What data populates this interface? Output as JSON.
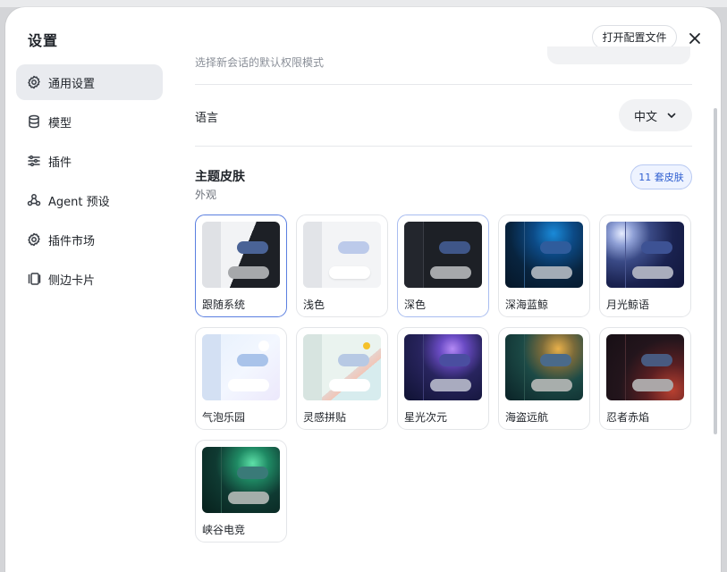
{
  "dialog": {
    "title": "设置",
    "open_config_label": "打开配置文件"
  },
  "sidebar": {
    "items": [
      {
        "label": "通用设置",
        "icon": "gear-icon",
        "active": true
      },
      {
        "label": "模型",
        "icon": "database-icon",
        "active": false
      },
      {
        "label": "插件",
        "icon": "sliders-icon",
        "active": false
      },
      {
        "label": "Agent 预设",
        "icon": "agent-icon",
        "active": false
      },
      {
        "label": "插件市场",
        "icon": "gear-icon",
        "active": false
      },
      {
        "label": "侧边卡片",
        "icon": "cards-icon",
        "active": false
      }
    ]
  },
  "general": {
    "permission_desc": "选择新会话的默认权限模式",
    "language_label": "语言",
    "language_value": "中文",
    "theme_title": "主题皮肤",
    "theme_subtitle": "外观",
    "theme_count": "11 套皮肤"
  },
  "themes": [
    {
      "label": "跟随系统",
      "variant": "system",
      "selected": "strong"
    },
    {
      "label": "浅色",
      "variant": "light"
    },
    {
      "label": "深色",
      "variant": "dark",
      "selected": "soft"
    },
    {
      "label": "深海蓝鲸",
      "variant": "ocean"
    },
    {
      "label": "月光鲸语",
      "variant": "moon"
    },
    {
      "label": "气泡乐园",
      "variant": "bubble"
    },
    {
      "label": "灵感拼贴",
      "variant": "collage"
    },
    {
      "label": "星光次元",
      "variant": "star"
    },
    {
      "label": "海盗远航",
      "variant": "pirate"
    },
    {
      "label": "忍者赤焰",
      "variant": "ninja"
    },
    {
      "label": "峡谷电竞",
      "variant": "canyon"
    }
  ],
  "colors": {
    "accent": "#5b7fe0",
    "badge_text": "#2f5fd0"
  }
}
